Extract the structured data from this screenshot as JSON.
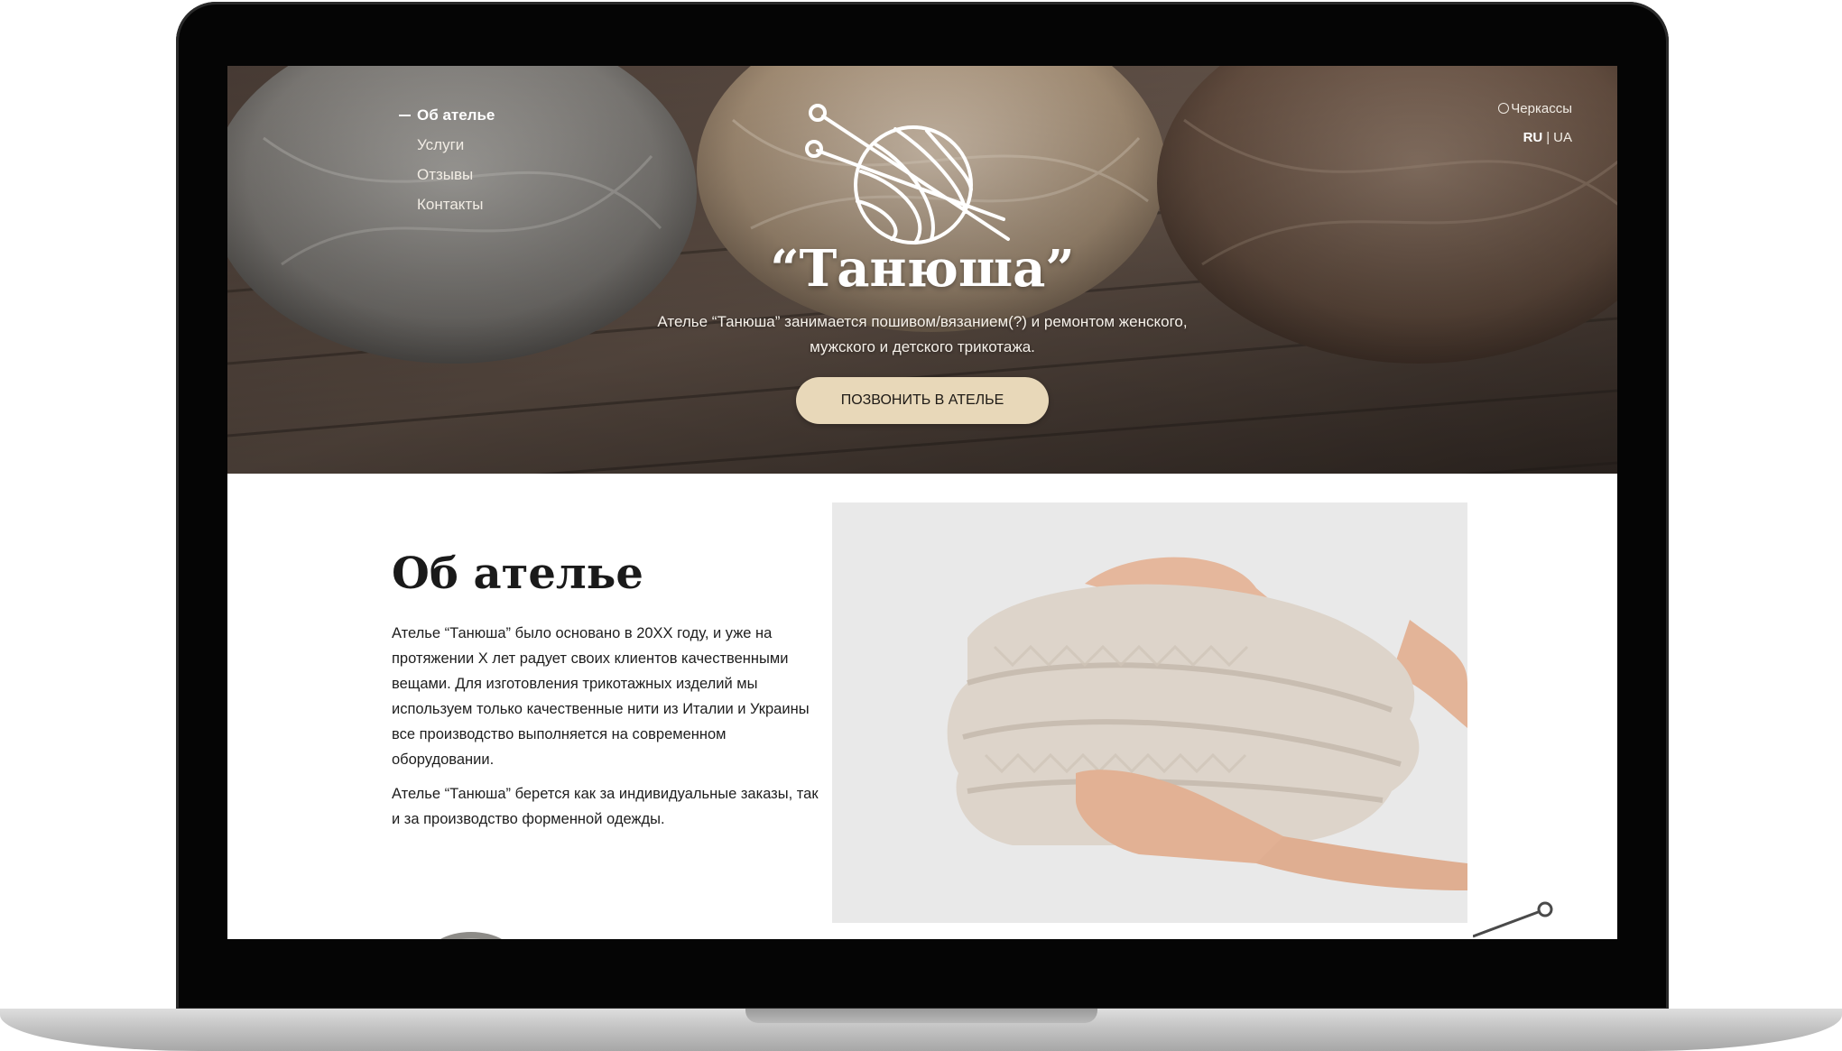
{
  "nav": {
    "items": [
      {
        "label": "Об ателье",
        "active": true
      },
      {
        "label": "Услуги",
        "active": false
      },
      {
        "label": "Отзывы",
        "active": false
      },
      {
        "label": "Контакты",
        "active": false
      }
    ]
  },
  "header_right": {
    "city": "Черкассы",
    "lang_ru": "RU",
    "lang_sep": "|",
    "lang_ua": "UA"
  },
  "hero": {
    "brand": "“Танюша”",
    "description": "Ателье “Танюша” занимается  пошивом/вязанием(?) и ремонтом женского, мужского и детского трикотажа.",
    "cta_label": "ПОЗВОНИТЬ В АТЕЛЬЕ"
  },
  "about": {
    "title": "Об ателье",
    "paragraph_1": "Ателье “Танюша” было основано в  20ХХ году, и уже на протяжении Х лет радует своих клиентов качественными вещами. Для изготовления трикотажных изделий мы используем только качественные нити из Италии и Украины все производство выполняется на современном оборудовании.",
    "paragraph_2": "Ателье “Танюша” берется как за индивидуальные заказы, так и за производство форменной одежды."
  },
  "colors": {
    "cta_background": "#e8d8b9",
    "laptop_frame": "#050505",
    "text_dark": "#1a1a1a"
  },
  "icons": [
    "yarn-ball-logo-icon",
    "map-pin-icon"
  ]
}
